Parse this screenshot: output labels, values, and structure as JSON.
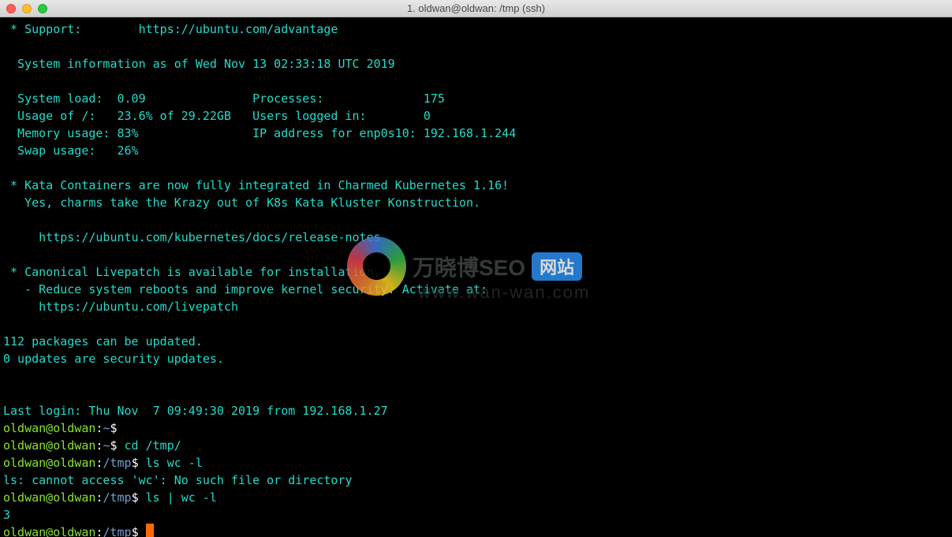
{
  "titlebar": {
    "title": "1. oldwan@oldwan: /tmp (ssh)"
  },
  "motd": {
    "support_label": " * Support:        ",
    "support_url": "https://ubuntu.com/advantage",
    "sysinfo_header": "  System information as of Wed Nov 13 02:33:18 UTC 2019",
    "load_label": "  System load:  ",
    "load_value": "0.09",
    "proc_label": "Processes:           ",
    "proc_value": "175",
    "usage_label": "  Usage of /:   ",
    "usage_value": "23.6% of 29.22GB",
    "users_label": "Users logged in:     ",
    "users_value": "0",
    "mem_label": "  Memory usage: ",
    "mem_value": "83%",
    "ip_label": "IP address for enp0s10: ",
    "ip_value": "192.168.1.244",
    "swap_label": "  Swap usage:   ",
    "swap_value": "26%",
    "kata1": " * Kata Containers are now fully integrated in Charmed Kubernetes 1.16!",
    "kata2": "   Yes, charms take the Krazy out of K8s Kata Kluster Konstruction.",
    "kata_url": "     https://ubuntu.com/kubernetes/docs/release-notes",
    "livepatch1": " * Canonical Livepatch is available for installation.",
    "livepatch2": "   - Reduce system reboots and improve kernel security. Activate at:",
    "livepatch_url": "     https://ubuntu.com/livepatch",
    "pkg1": "112 packages can be updated.",
    "pkg2": "0 updates are security updates.",
    "lastlogin": "Last login: Thu Nov  7 09:49:30 2019 from 192.168.1.27"
  },
  "prompts": {
    "user": "oldwan@oldwan",
    "home": "~",
    "tmp": "/tmp",
    "dollar": "$",
    "cmd1": " ",
    "cmd2": " cd /tmp/",
    "cmd3": " ls wc -l",
    "err": "ls: cannot access 'wc': No such file or directory",
    "cmd4": " ls | wc -l",
    "out4": "3",
    "cmd5": " "
  },
  "watermark": {
    "text": "万晓博SEO",
    "badge": "网站",
    "sub": "www.wan-wan.com"
  }
}
